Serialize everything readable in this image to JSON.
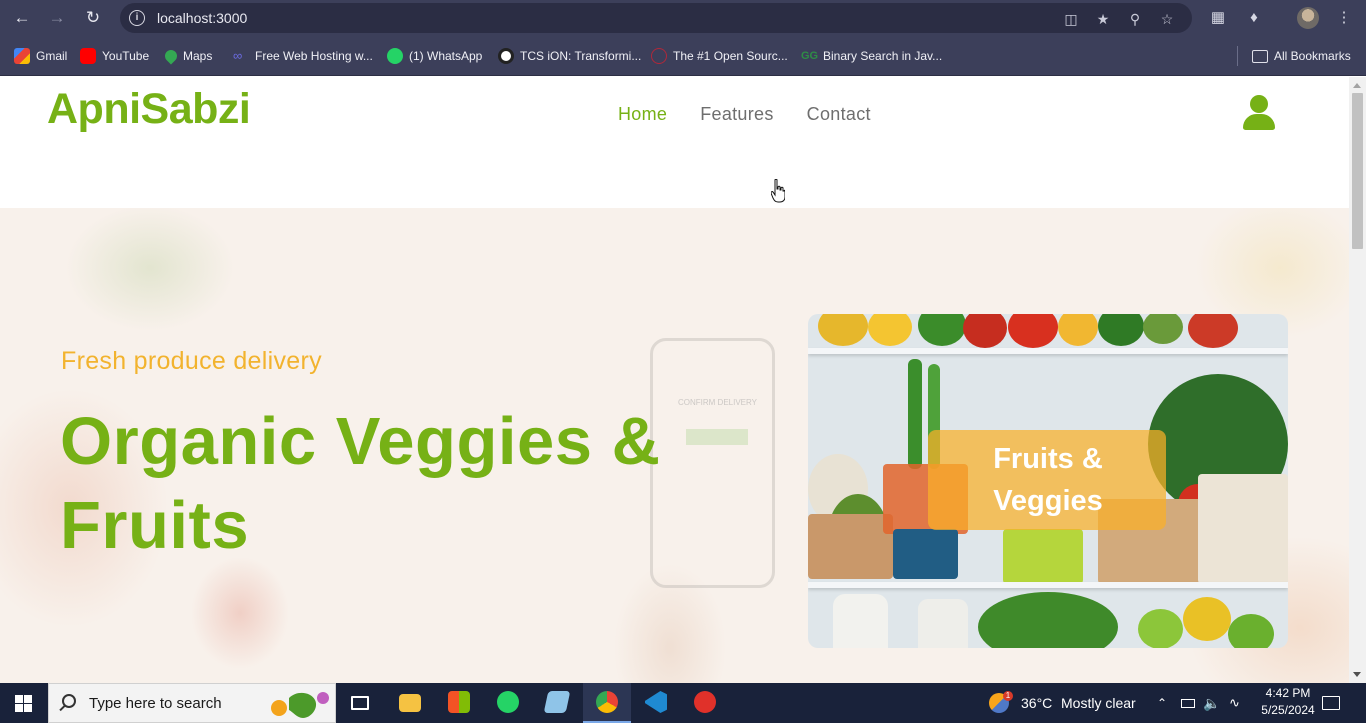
{
  "browser": {
    "url": "localhost:3000",
    "bookmarks": [
      {
        "label": "Gmail",
        "icon": "gmail-icon",
        "color": "#ea4335"
      },
      {
        "label": "YouTube",
        "icon": "youtube-icon",
        "color": "#ff0000"
      },
      {
        "label": "Maps",
        "icon": "maps-icon",
        "color": "#34a853"
      },
      {
        "label": "Free Web Hosting w...",
        "icon": "hosting-icon",
        "color": "#5b5bd6"
      },
      {
        "label": "(1) WhatsApp",
        "icon": "whatsapp-icon",
        "color": "#25d366"
      },
      {
        "label": "TCS iON: Transformi...",
        "icon": "tcs-icon",
        "color": "#ffffff"
      },
      {
        "label": "The #1 Open Sourc...",
        "icon": "opensource-icon",
        "color": "#b0283a"
      },
      {
        "label": "Binary Search in Jav...",
        "icon": "gfg-icon",
        "color": "#2f8d46"
      }
    ],
    "all_bookmarks": "All Bookmarks"
  },
  "site": {
    "logo": "ApniSabzi",
    "nav": [
      {
        "label": "Home",
        "active": true
      },
      {
        "label": "Features",
        "active": false
      },
      {
        "label": "Contact",
        "active": false
      }
    ],
    "accent": "#76b116",
    "tagline_color": "#f2b32e"
  },
  "hero": {
    "tagline": "Fresh produce delivery",
    "headline_line1": "Organic Veggies &",
    "headline_line2": "Fruits",
    "card_caption_line1": "Fruits &",
    "card_caption_line2": "Veggies",
    "background_phone_text": "CONFIRM DELIVERY"
  },
  "taskbar": {
    "search_placeholder": "Type here to search",
    "weather_temp": "36°C",
    "weather_desc": "Mostly clear",
    "time": "4:42 PM",
    "date": "5/25/2024",
    "weather_badge": "1"
  }
}
